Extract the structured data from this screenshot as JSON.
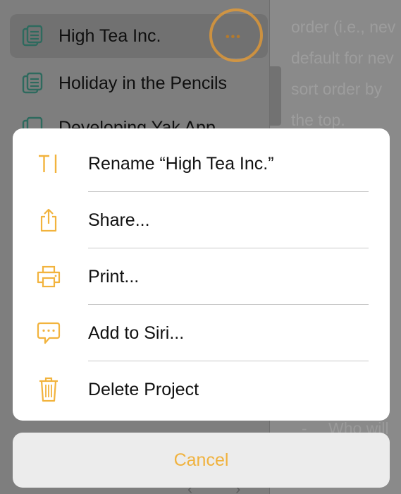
{
  "sidebar": {
    "projects": [
      {
        "name": "High Tea Inc.",
        "selected": true
      },
      {
        "name": "Holiday in the Pencils",
        "selected": false
      },
      {
        "name": "Developing Yak App",
        "selected": false
      }
    ],
    "more_button_glyph": "•••"
  },
  "content_fragments": {
    "line1": "order (i.e., nev",
    "line2": "default for nev",
    "line3": "sort order by",
    "line4": "the top.",
    "bullet_text": "Who will"
  },
  "action_sheet": {
    "items": [
      {
        "label": "Rename “High Tea Inc.”",
        "icon": "text-cursor-icon"
      },
      {
        "label": "Share...",
        "icon": "share-icon"
      },
      {
        "label": "Print...",
        "icon": "printer-icon"
      },
      {
        "label": "Add to Siri...",
        "icon": "siri-speech-bubble-icon"
      },
      {
        "label": "Delete Project",
        "icon": "trash-icon"
      }
    ],
    "cancel_label": "Cancel"
  },
  "colors": {
    "accent": "#F2B33D",
    "highlight_ring": "#F4A02C",
    "doc_icon": "#2E6A5E"
  }
}
